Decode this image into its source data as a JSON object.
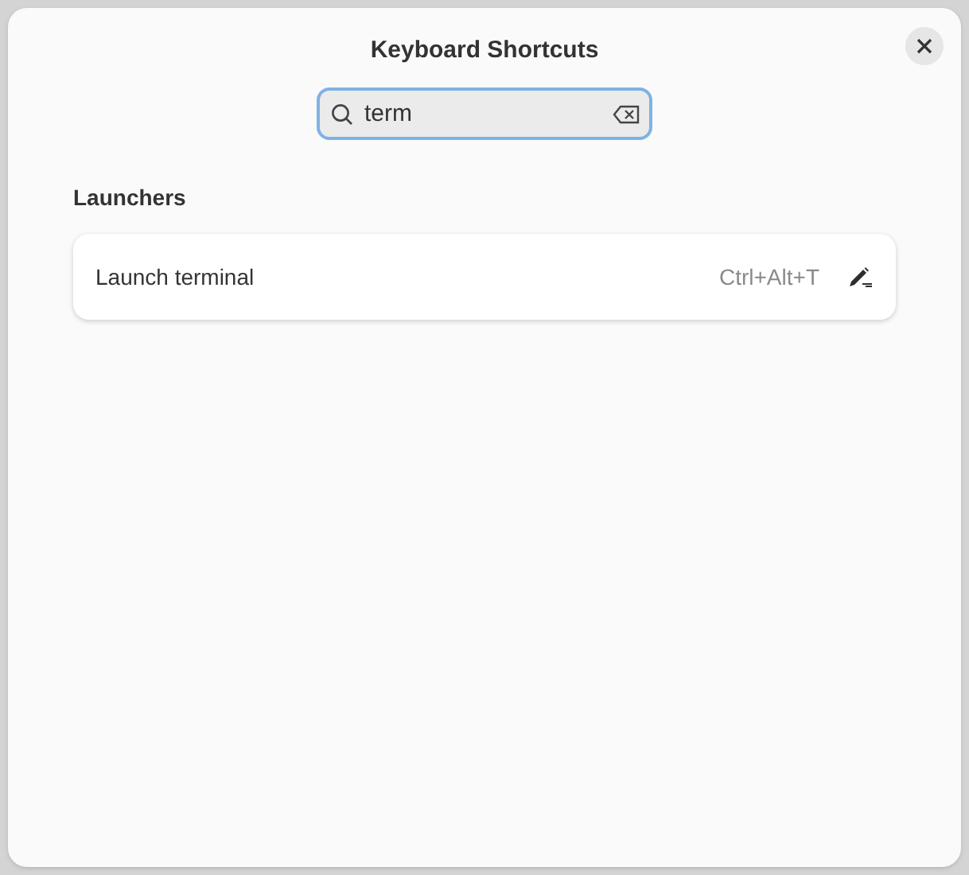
{
  "window": {
    "title": "Keyboard Shortcuts"
  },
  "search": {
    "value": "term"
  },
  "sections": [
    {
      "title": "Launchers",
      "rows": [
        {
          "label": "Launch terminal",
          "shortcut": "Ctrl+Alt+T"
        }
      ]
    }
  ]
}
